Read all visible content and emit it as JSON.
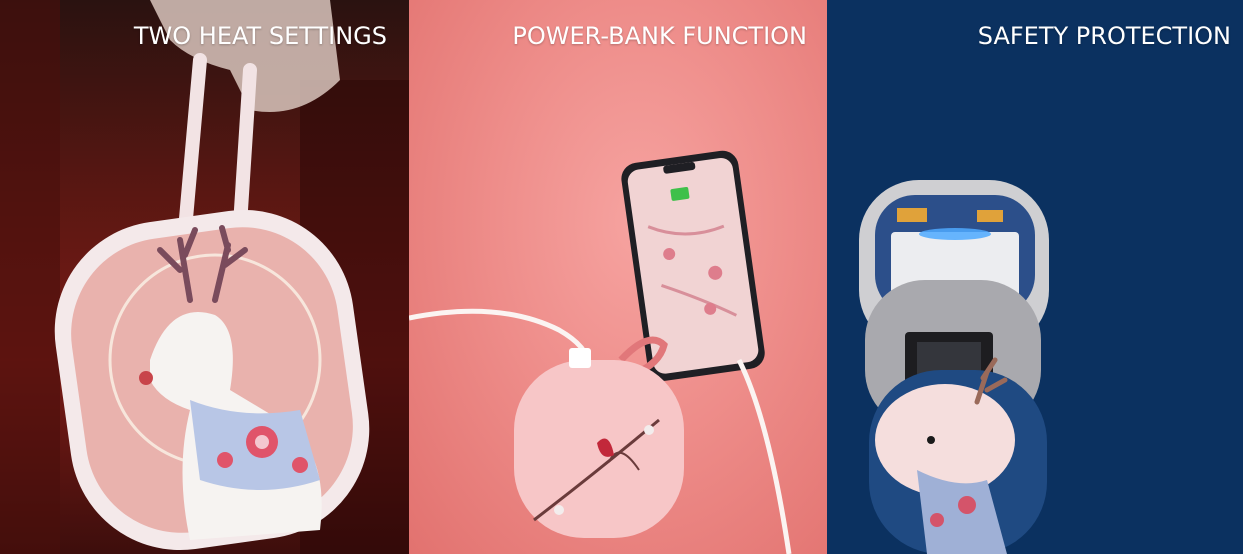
{
  "panels": [
    {
      "caption": "TWO HEAT SETTINGS",
      "background": "#6e1a15"
    },
    {
      "caption": "POWER-BANK FUNCTION",
      "background": "#ee8d8a"
    },
    {
      "caption": "SAFETY PROTECTION",
      "background": "#0b3160"
    }
  ]
}
